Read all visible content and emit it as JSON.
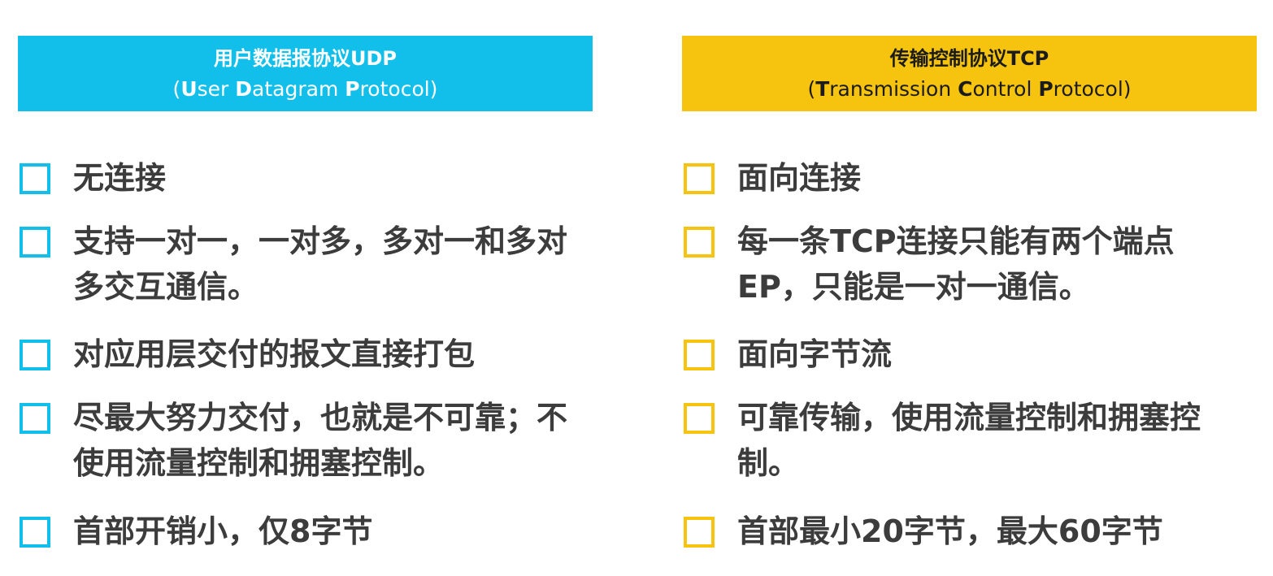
{
  "udp": {
    "title": "用户数据报协议UDP",
    "subtitle_parts": [
      "(",
      "U",
      "ser ",
      "D",
      "atagram ",
      "P",
      "rotocol)"
    ],
    "items": [
      "无连接",
      "支持一对一，一对多，多对一和多对多交互通信。",
      "对应用层交付的报文直接打包",
      "尽最大努力交付，也就是不可靠；不使用流量控制和拥塞控制。",
      "首部开销小，仅8字节"
    ],
    "accent_color": "#12bfea"
  },
  "tcp": {
    "title": "传输控制协议TCP",
    "subtitle_parts": [
      "(",
      "T",
      "ransmission ",
      "C",
      "ontrol ",
      "P",
      "rotocol)"
    ],
    "items": [
      "面向连接",
      "每一条TCP连接只能有两个端点EP，只能是一对一通信。",
      "面向字节流",
      "可靠传输，使用流量控制和拥塞控制。",
      "首部最小20字节，最大60字节"
    ],
    "accent_color": "#f6c40f"
  }
}
